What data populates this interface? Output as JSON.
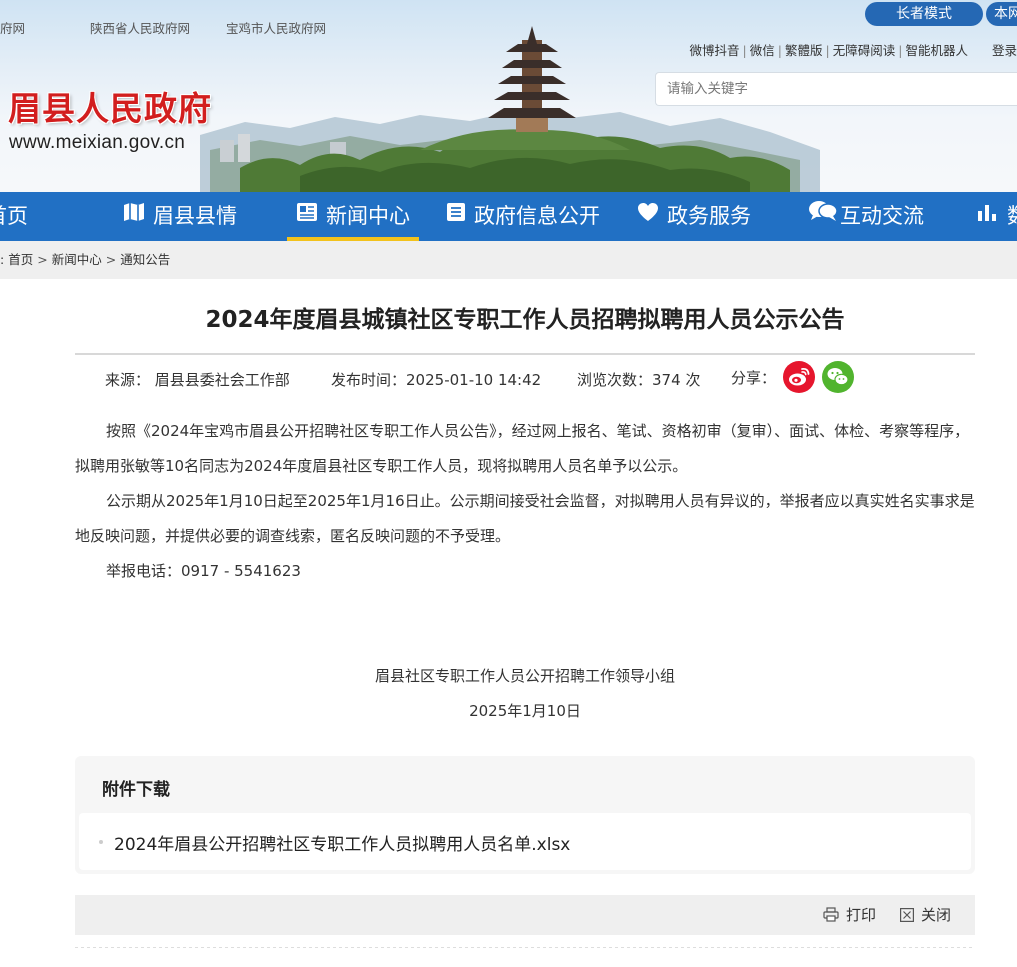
{
  "header": {
    "top_links": [
      "府网",
      "陕西省人民政府网",
      "宝鸡市人民政府网"
    ],
    "site_name": "眉县人民政府",
    "site_url": "www.meixian.gov.cn",
    "elder_mode": "长者模式",
    "site_search_label": "本网",
    "util_links": [
      "微博抖音",
      "微信",
      "繁體版",
      "无障碍阅读",
      "智能机器人",
      "登录"
    ],
    "search_placeholder": "请输入关键字"
  },
  "nav": {
    "items": [
      {
        "label": "首页",
        "icon": "home-icon"
      },
      {
        "label": "眉县县情",
        "icon": "map-icon"
      },
      {
        "label": "新闻中心",
        "icon": "news-icon",
        "active": true
      },
      {
        "label": "政府信息公开",
        "icon": "list-icon"
      },
      {
        "label": "政务服务",
        "icon": "heart-icon"
      },
      {
        "label": "互动交流",
        "icon": "chat-icon"
      },
      {
        "label": "数",
        "icon": "bar-chart-icon"
      }
    ],
    "accent_color": "#2170c4",
    "active_underline_color": "#f2c21c"
  },
  "breadcrumb": {
    "prefix": ":",
    "items": [
      "首页",
      "新闻中心",
      "通知公告"
    ]
  },
  "article": {
    "title": "2024年度眉县城镇社区专职工作人员招聘拟聘用人员公示公告",
    "source_label": "来源：",
    "source": "眉县县委社会工作部",
    "publish_label": "发布时间：",
    "publish_time": "2025-01-10 14:42",
    "views_label": "浏览次数：",
    "views": "374",
    "views_unit": "次",
    "share_label": "分享：",
    "paragraphs": [
      "按照《2024年宝鸡市眉县公开招聘社区专职工作人员公告》，经过网上报名、笔试、资格初审（复审）、面试、体检、考察等程序，拟聘用张敏等10名同志为2024年度眉县社区专职工作人员，现将拟聘用人员名单予以公示。",
      "公示期从2025年1月10日起至2025年1月16日止。公示期间接受社会监督，对拟聘用人员有异议的，举报者应以真实姓名实事求是地反映问题，并提供必要的调查线索，匿名反映问题的不予受理。",
      "举报电话：0917 - 5541623"
    ],
    "signature_org": "眉县社区专职工作人员公开招聘工作领导小组",
    "signature_date": "2025年1月10日"
  },
  "attachments": {
    "title": "附件下载",
    "files": [
      "2024年眉县公开招聘社区专职工作人员拟聘用人员名单.xlsx"
    ]
  },
  "tools": {
    "print": "打印",
    "close": "关闭"
  },
  "colors": {
    "weibo": "#e6162d",
    "wechat": "#51b42e",
    "logo_red": "#d21e1e"
  }
}
